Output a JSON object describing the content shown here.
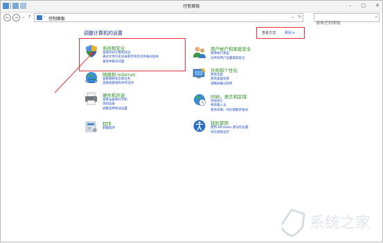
{
  "window": {
    "title": "控制面板",
    "minimize": "–",
    "maximize": "□",
    "close": "✕"
  },
  "address": {
    "back": "←",
    "forward": "→",
    "recent": "⌄",
    "up": "↑",
    "sep": "›",
    "path": "控制面板",
    "dropdown": "⌄",
    "refresh": "↻",
    "search_placeholder": "搜索控制面板",
    "search_icon": "search-icon"
  },
  "main": {
    "heading": "调整计算机的设置",
    "view_by": {
      "label": "查看方式:",
      "value": "类别 ▾"
    }
  },
  "categories": [
    {
      "key": "system",
      "icon": "shield-icon",
      "title": "系统和安全",
      "links": [
        "查看你的计算机状态",
        "通过文件历史记录保存你的文件备份副本",
        "查找并解决问题"
      ]
    },
    {
      "key": "network",
      "icon": "globe-icon",
      "title": "网络和 Internet",
      "links": [
        "查看网络状态和任务",
        "选择家庭组和共享选项"
      ]
    },
    {
      "key": "hardware",
      "icon": "printer-icon",
      "title": "硬件和声音",
      "links": [
        "查看设备和打印机",
        "添加设备",
        "调整常用移动设置"
      ]
    },
    {
      "key": "programs",
      "icon": "programs-icon",
      "title": "程序",
      "links": [
        "卸载程序"
      ]
    },
    {
      "key": "users",
      "icon": "users-icon",
      "title": "用户帐户和家庭安全",
      "links": [
        "更改帐户类型",
        "为所有用户设置家庭安全"
      ]
    },
    {
      "key": "appearance",
      "icon": "appearance-icon",
      "title": "外观和个性化",
      "links": [
        "更改主题",
        "更改桌面背景",
        "调整屏幕分辨率"
      ]
    },
    {
      "key": "clock",
      "icon": "clock-globe-icon",
      "title": "时钟、语言和区域",
      "links": [
        "添加语言",
        "更改输入法",
        "更改日期、时间或数字格式"
      ]
    },
    {
      "key": "ease",
      "icon": "ease-of-access-icon",
      "title": "轻松使用",
      "links": [
        "使用 Windows 建议的设置",
        "优化视频显示"
      ]
    }
  ],
  "watermark": {
    "text": "系统之家"
  },
  "colors": {
    "accent_green": "#2b8f22",
    "link_blue": "#1f4cbe",
    "heading_blue": "#1e3287",
    "highlight_red": "#e23434"
  }
}
